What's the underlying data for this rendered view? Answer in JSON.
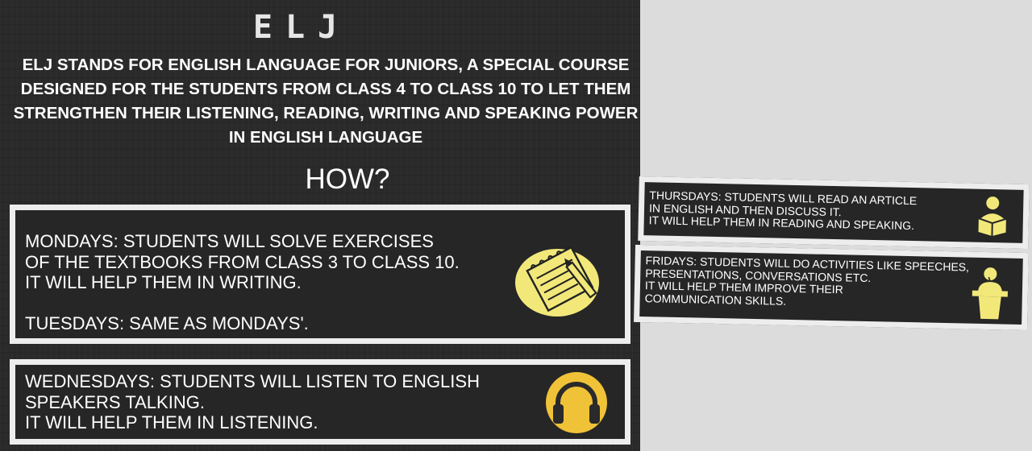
{
  "header": {
    "logo_text": "ELJ",
    "intro_text": "ELJ STANDS FOR ENGLISH LANGUAGE FOR JUNIORS, A SPECIAL COURSE DESIGNED FOR THE STUDENTS FROM CLASS 4 TO CLASS 10 TO LET THEM STRENGTHEN THEIR LISTENING, READING, WRITING AND SPEAKING POWER IN ENGLISH LANGUAGE",
    "section_title": "HOW?"
  },
  "cards": {
    "monday_tuesday": {
      "text": "MONDAYS: STUDENTS WILL SOLVE EXERCISES\nOF THE TEXTBOOKS FROM CLASS 3 TO CLASS 10.\nIT WILL HELP THEM IN WRITING.\n\nTUESDAYS: SAME AS MONDAYS'.",
      "icon": "notepad-pencil-icon"
    },
    "wednesday": {
      "text": "WEDNESDAYS: STUDENTS WILL LISTEN TO ENGLISH\nSPEAKERS TALKING.\nIT WILL HELP THEM IN LISTENING.",
      "icon": "headphones-icon"
    },
    "thursday": {
      "text": "THURSDAYS: STUDENTS WILL READ AN ARTICLE\nIN ENGLISH AND THEN DISCUSS IT.\nIT WILL HELP THEM IN READING AND SPEAKING.",
      "icon": "reader-icon"
    },
    "friday": {
      "text": "FRIDAYS: STUDENTS WILL DO ACTIVITIES LIKE SPEECHES,\nPRESENTATIONS, CONVERSATIONS ETC.\nIT WILL HELP THEM IMPROVE THEIR\nCOMMUNICATION SKILLS.",
      "icon": "podium-speaker-icon"
    }
  },
  "colors": {
    "chalkboard": "#2a2a2a",
    "card_border": "#ededed",
    "icon_yellow": "#f2e87a",
    "icon_gold": "#f0c238",
    "background": "#dcdcdc"
  }
}
